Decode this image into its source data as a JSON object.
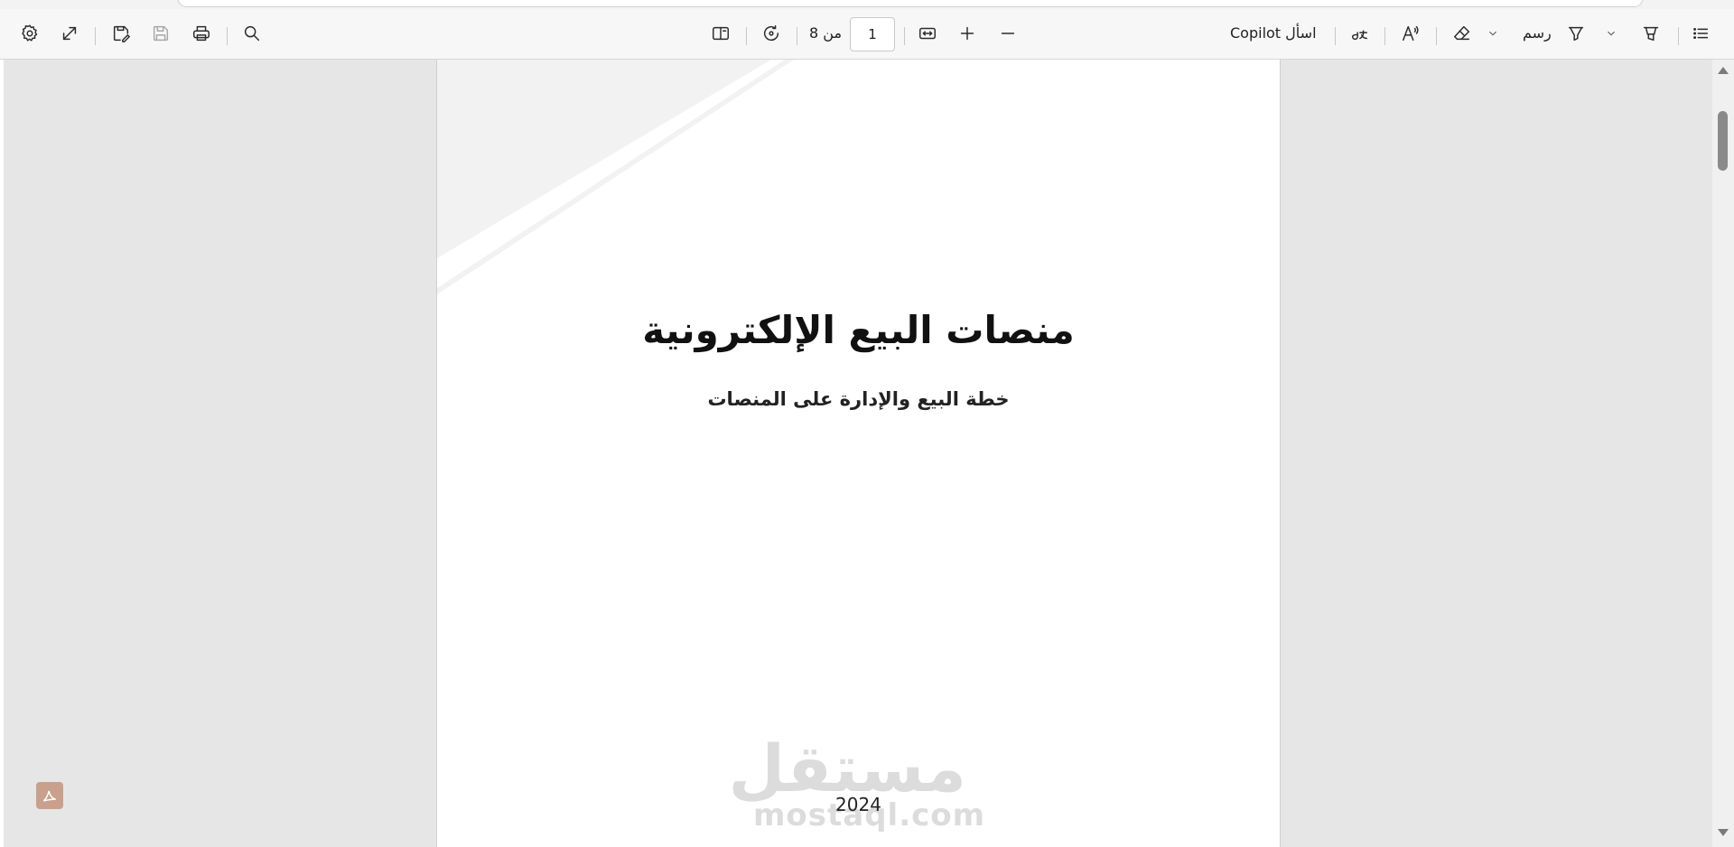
{
  "toolbar": {
    "left": {
      "settings_icon": "gear-icon",
      "fullscreen_icon": "expand-icon",
      "save_as_icon": "save-edit-icon",
      "save_icon": "save-icon",
      "print_icon": "print-icon",
      "search_icon": "search-icon"
    },
    "center": {
      "page_view_icon": "page-view-icon",
      "rotate_icon": "rotate-icon",
      "page_total_label": "من 8",
      "current_page": "1",
      "fit_width_icon": "fit-width-icon",
      "zoom_in_icon": "plus-icon",
      "zoom_out_icon": "minus-icon"
    },
    "right": {
      "copilot_label": "اسأل Copilot",
      "translate_icon": "translate-icon",
      "read_aloud_icon": "read-aloud-icon",
      "erase_icon": "eraser-icon",
      "draw_label": "رسم",
      "draw_icon": "pen-icon",
      "highlight_icon": "highlighter-icon",
      "contents_icon": "list-icon"
    }
  },
  "document": {
    "title": "منصات البيع الإلكترونية",
    "subtitle": "خطة البيع والإدارة على المنصات",
    "year": "2024",
    "watermark_ar": "مستقل",
    "watermark_en": "mostaql.com"
  },
  "colors": {
    "toolbar_bg": "#f7f7f7",
    "viewer_bg": "#e6e6e6",
    "page_bg": "#ffffff",
    "watermark": "#dcdcdc",
    "acrobat_badge": "#c9a08d"
  }
}
